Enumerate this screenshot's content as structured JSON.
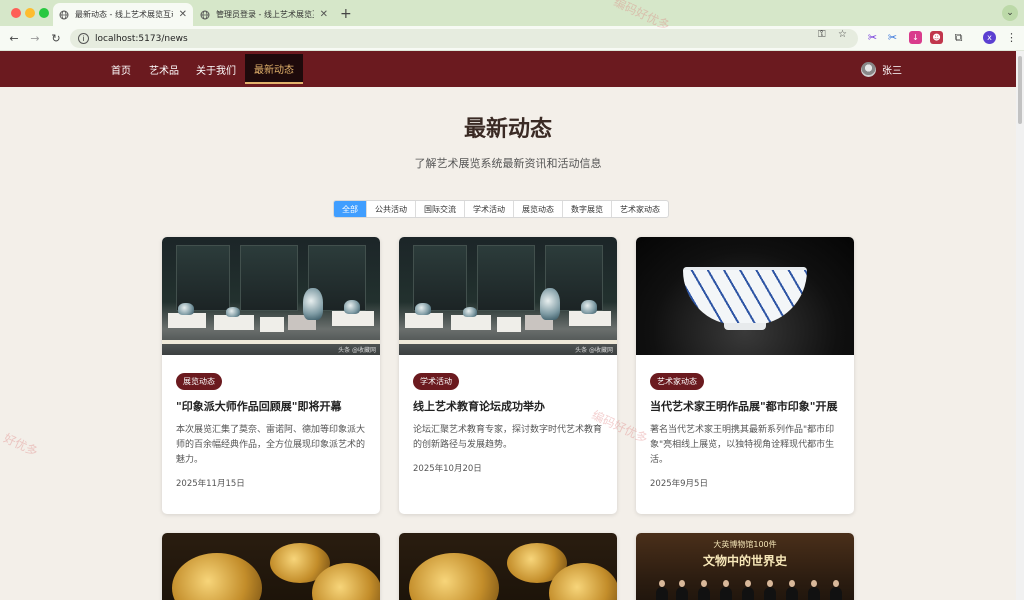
{
  "browser": {
    "tabs": [
      {
        "title": "最新动态 - 线上艺术展览互动平台",
        "active": true
      },
      {
        "title": "管理员登录 - 线上艺术展览互动平台",
        "active": false
      }
    ],
    "new_tab": "+",
    "url": "localhost:5173/news",
    "profile_initial": "x"
  },
  "site_nav": {
    "items": [
      "首页",
      "艺术品",
      "关于我们",
      "最新动态"
    ],
    "active": "最新动态",
    "user_name": "张三"
  },
  "page": {
    "title": "最新动态",
    "subtitle": "了解艺术展览系统最新资讯和活动信息"
  },
  "filters": [
    "全部",
    "公共活动",
    "国际交流",
    "学术活动",
    "展览动态",
    "数字展览",
    "艺术家动态"
  ],
  "active_filter": "全部",
  "news": [
    {
      "tag": "展览动态",
      "title": "\"印象派大师作品回顾展\"即将开幕",
      "desc": "本次展览汇集了莫奈、雷诺阿、德加等印象派大师的百余幅经典作品，全方位展现印象派艺术的魅力。",
      "date": "2025年11月15日",
      "image": "exhibition-hall"
    },
    {
      "tag": "学术活动",
      "title": "线上艺术教育论坛成功举办",
      "desc": "论坛汇聚艺术教育专家，探讨数字时代艺术教育的创新路径与发展趋势。",
      "date": "2025年10月20日",
      "image": "exhibition-hall"
    },
    {
      "tag": "艺术家动态",
      "title": "当代艺术家王明作品展\"都市印象\"开展",
      "desc": "著名当代艺术家王明携其最新系列作品\"都市印象\"亮相线上展览，以独特视角诠释现代都市生活。",
      "date": "2025年9月5日",
      "image": "porcelain-bowl"
    }
  ],
  "bottom_card_texts": {
    "museum_line1": "大英博物馆100件",
    "museum_line2": "文物中的世界史"
  },
  "image_watermark": "头条 @收藏网",
  "page_watermarks": [
    "编码好优多",
    "好优多",
    "编码好优多"
  ],
  "colors": {
    "nav_bg": "#6b1a1f",
    "active_nav": "#e3b36c",
    "filter_active": "#409eff",
    "tag_bg": "#6b1a1f",
    "page_bg": "#f3efe9"
  }
}
